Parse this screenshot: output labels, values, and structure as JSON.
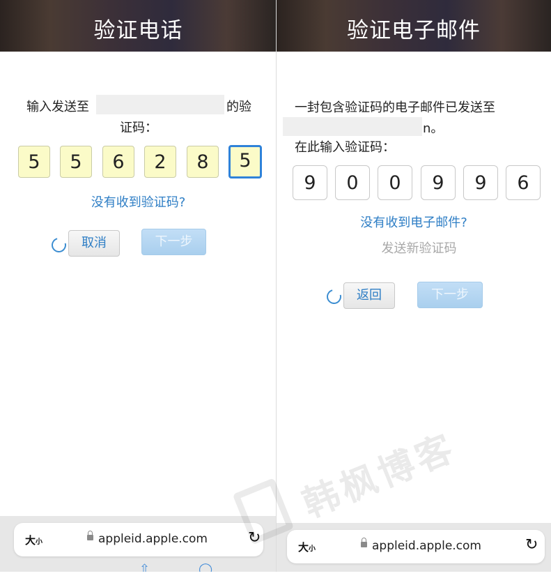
{
  "left": {
    "title": "验证电话",
    "prompt_line1_a": "输入发送至",
    "prompt_line1_b": "的验",
    "prompt_line2": "证码：",
    "code_digits": [
      "5",
      "5",
      "6",
      "2",
      "8",
      "5"
    ],
    "no_code_link": "没有收到验证码?",
    "cancel_button": "取消",
    "next_button": "下一步",
    "size_label": "大",
    "size_label_small": "小",
    "url": "appleid.apple.com"
  },
  "right": {
    "title": "验证电子邮件",
    "prompt_line1": "一封包含验证码的电子邮件已发送至",
    "prompt_line2_tail": "n。",
    "prompt_line3": "在此输入验证码：",
    "code_digits": [
      "9",
      "0",
      "0",
      "9",
      "9",
      "6"
    ],
    "no_email_link": "没有收到电子邮件?",
    "resend_text": "发送新验证码",
    "back_button": "返回",
    "next_button": "下一步",
    "size_label": "大",
    "size_label_small": "小",
    "url": "appleid.apple.com"
  },
  "watermark": "韩枫博客",
  "colors": {
    "link_blue": "#2e7ec5",
    "input_yellow": "#fbfbc8",
    "active_border": "#2f82d9",
    "disabled_button": "#a9cfee"
  }
}
